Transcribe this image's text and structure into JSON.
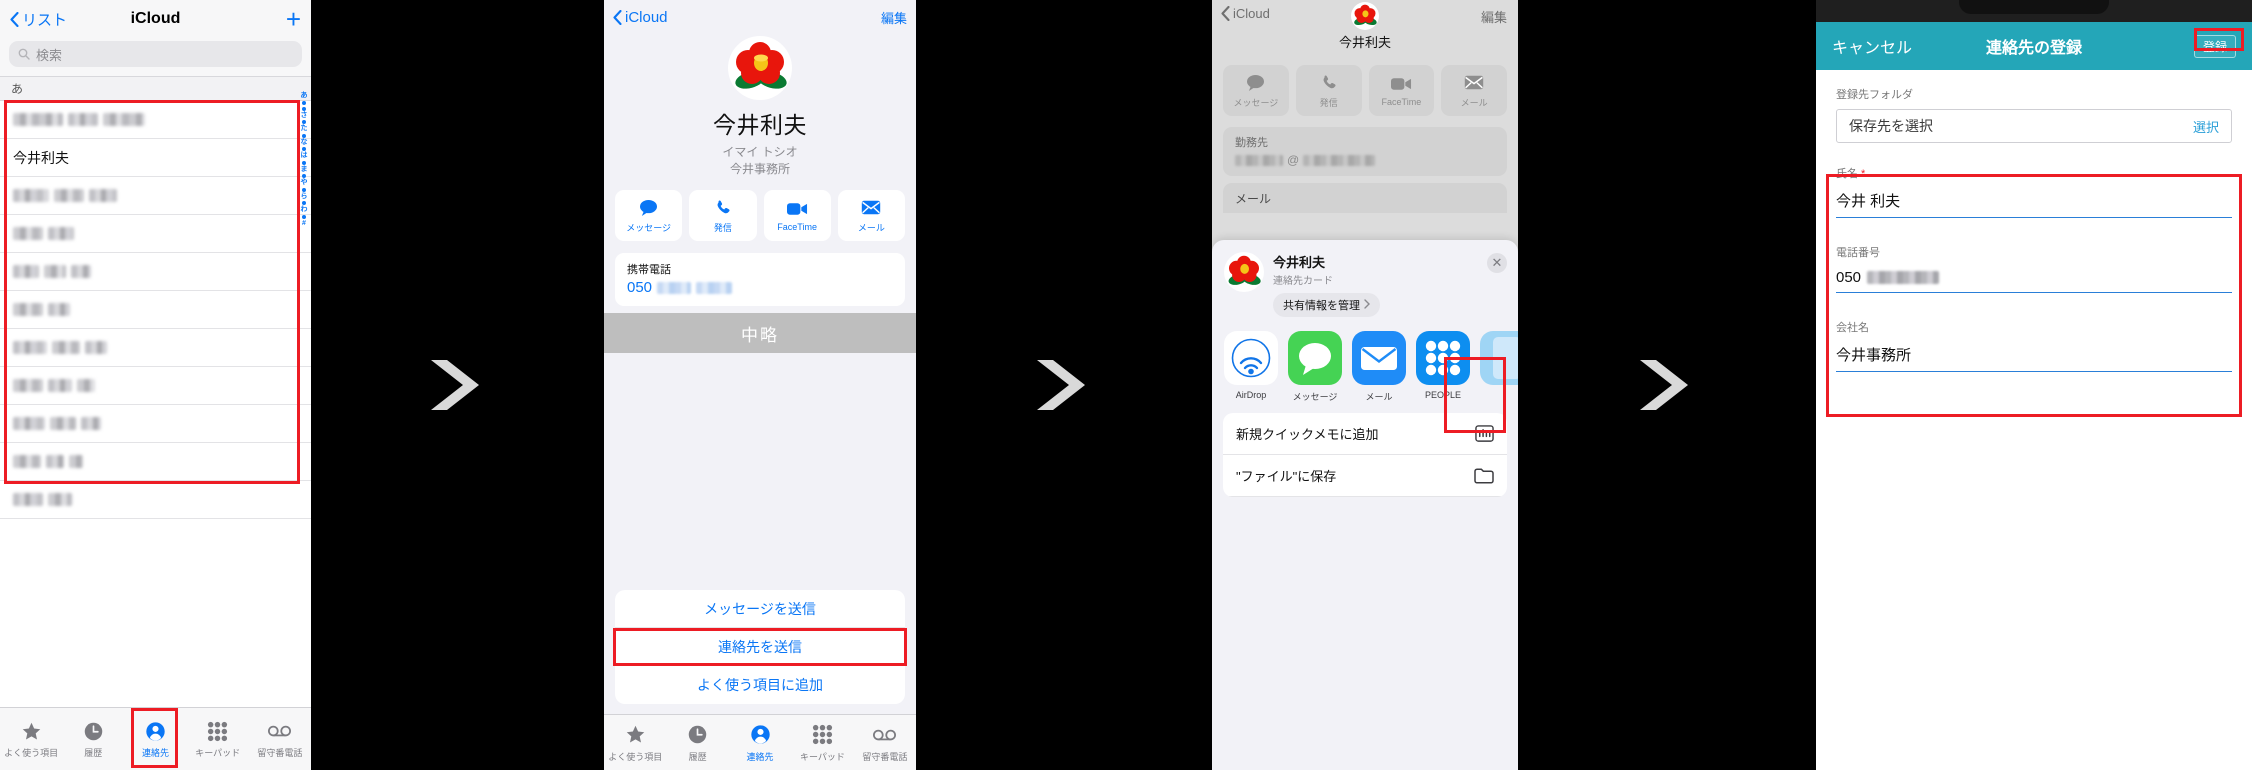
{
  "panel1": {
    "nav": {
      "back_label": "リスト",
      "title": "iCloud",
      "add_label": "+"
    },
    "search": {
      "placeholder": "検索"
    },
    "section_header": "あ",
    "contacts": [
      {
        "name": "",
        "redacted": true
      },
      {
        "name": "今井利夫",
        "redacted": false
      },
      {
        "name": "",
        "redacted": true
      },
      {
        "name": "",
        "redacted": true
      },
      {
        "name": "",
        "redacted": true
      },
      {
        "name": "",
        "redacted": true
      },
      {
        "name": "",
        "redacted": true
      },
      {
        "name": "",
        "redacted": true
      },
      {
        "name": "",
        "redacted": true
      },
      {
        "name": "",
        "redacted": true
      },
      {
        "name": "",
        "redacted": true
      }
    ],
    "index_letters": [
      "あ",
      "",
      "さ",
      "た",
      "な",
      "は",
      "ま",
      "や",
      "ら",
      "わ",
      "#"
    ],
    "tabs": [
      {
        "label": "よく使う項目",
        "icon": "star-icon",
        "active": false
      },
      {
        "label": "履歴",
        "icon": "clock-icon",
        "active": false
      },
      {
        "label": "連絡先",
        "icon": "person-icon",
        "active": true
      },
      {
        "label": "キーパッド",
        "icon": "keypad-icon",
        "active": false
      },
      {
        "label": "留守番電話",
        "icon": "voicemail-icon",
        "active": false
      }
    ]
  },
  "panel2": {
    "nav": {
      "back_label": "iCloud",
      "edit_label": "編集"
    },
    "contact": {
      "name": "今井利夫",
      "reading": "イマイ トシオ",
      "organization": "今井事務所"
    },
    "actions": [
      {
        "label": "メッセージ",
        "icon": "message-bubble-icon"
      },
      {
        "label": "発信",
        "icon": "phone-icon"
      },
      {
        "label": "FaceTime",
        "icon": "video-camera-icon"
      },
      {
        "label": "メール",
        "icon": "envelope-icon"
      }
    ],
    "phone_card": {
      "label": "携帯電話",
      "value_prefix": "050",
      "value_redacted": true
    },
    "omission_banner": "中略",
    "sheet_rows": [
      {
        "label": "メッセージを送信",
        "highlighted": false
      },
      {
        "label": "連絡先を送信",
        "highlighted": true
      },
      {
        "label": "よく使う項目に追加",
        "highlighted": false
      }
    ],
    "tabs": [
      {
        "label": "よく使う項目",
        "icon": "star-icon",
        "active": false
      },
      {
        "label": "履歴",
        "icon": "clock-icon",
        "active": false
      },
      {
        "label": "連絡先",
        "icon": "person-icon",
        "active": true
      },
      {
        "label": "キーパッド",
        "icon": "keypad-icon",
        "active": false
      },
      {
        "label": "留守番電話",
        "icon": "voicemail-icon",
        "active": false
      }
    ]
  },
  "panel3": {
    "nav": {
      "back_label": "iCloud",
      "edit_label": "編集",
      "name": "今井利夫"
    },
    "actions": [
      {
        "label": "メッセージ",
        "icon": "message-bubble-icon"
      },
      {
        "label": "発信",
        "icon": "phone-icon"
      },
      {
        "label": "FaceTime",
        "icon": "video-camera-icon"
      },
      {
        "label": "メール",
        "icon": "envelope-icon"
      }
    ],
    "work_card": {
      "label": "勤務先",
      "value_redacted": true,
      "value_sep": "@"
    },
    "mail_card": {
      "label": "メール"
    },
    "share_header": {
      "name": "今井利夫",
      "subtitle": "連絡先カード",
      "manage_label": "共有情報を管理",
      "close_label": "✕"
    },
    "apps": [
      {
        "label": "AirDrop",
        "icon": "airdrop-icon",
        "highlighted": false
      },
      {
        "label": "メッセージ",
        "icon": "messages-app-icon",
        "highlighted": false
      },
      {
        "label": "メール",
        "icon": "mail-app-icon",
        "highlighted": false
      },
      {
        "label": "PEOPLE",
        "icon": "people-app-icon",
        "highlighted": true
      },
      {
        "label": "",
        "icon": "partial-app-icon",
        "highlighted": false
      }
    ],
    "list": [
      {
        "label": "新規クイックメモに追加",
        "icon": "quicknote-icon"
      },
      {
        "label": "\"ファイル\"に保存",
        "icon": "folder-icon"
      }
    ]
  },
  "panel4": {
    "nav": {
      "cancel_label": "キャンセル",
      "title": "連絡先の登録",
      "register_label": "登録"
    },
    "folder": {
      "label": "登録先フォルダ",
      "placeholder": "保存先を選択",
      "pick_label": "選択"
    },
    "fields": [
      {
        "label": "氏名",
        "required": true,
        "value": "今井 利夫",
        "redacted": false
      },
      {
        "label": "電話番号",
        "required": false,
        "value": "050",
        "redacted": true
      },
      {
        "label": "会社名",
        "required": false,
        "value": "今井事務所",
        "redacted": false
      }
    ]
  },
  "colors": {
    "ios_blue": "#0a76f5",
    "highlight_red": "#ed1c24",
    "teal_nav": "#24a6b8",
    "banner_gray": "#bebebe"
  }
}
